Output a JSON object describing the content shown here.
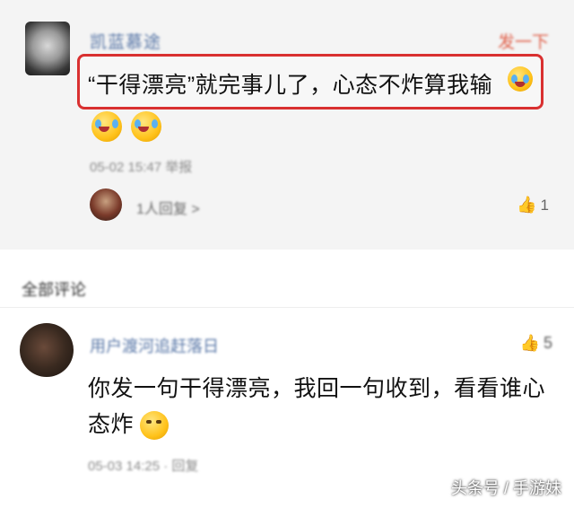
{
  "comment1": {
    "username": "凯蓝慕途",
    "reply_label": "发一下",
    "text": "“干得漂亮”就完事儿了，心态不炸算我输",
    "meta": "05-02 15:47 举报",
    "replies_label": "1人回复 >",
    "likes": "1"
  },
  "section": {
    "label": "全部评论"
  },
  "comment2": {
    "username": "用户渡河追赶落日",
    "likes": "5",
    "text": "你发一句干得漂亮，我回一句收到，看看谁心态炸",
    "meta": "05-03 14:25 · 回复"
  },
  "watermark": "头条号 / 手游妹",
  "icons": {
    "emoji_crying": "crying-laughing-emoji-icon",
    "emoji_thinking": "thinking-emoji-icon",
    "like": "thumb-up-icon"
  }
}
